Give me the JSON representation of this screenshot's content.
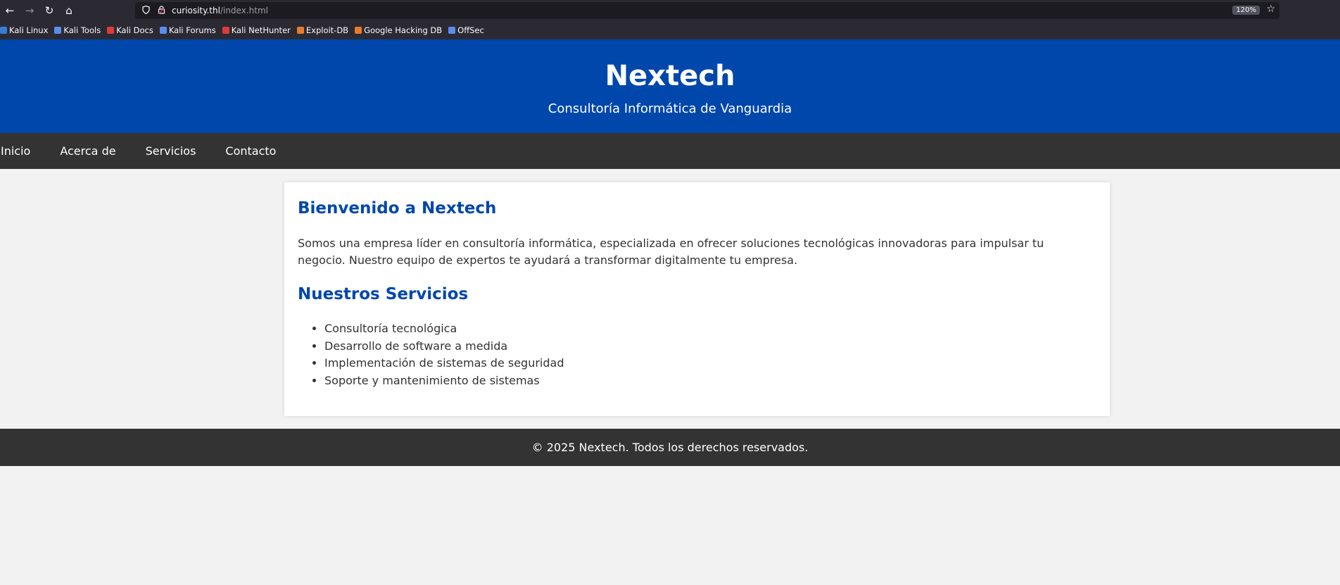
{
  "browser": {
    "nav": {
      "back": "←",
      "forward": "→",
      "reload": "↻",
      "home": "⌂"
    },
    "url": {
      "host": "curiosity.thl",
      "path": "/index.html"
    },
    "zoom": "120%",
    "bookmarks": [
      {
        "label": "Kali Linux",
        "color": "#3a7bd5"
      },
      {
        "label": "Kali Tools",
        "color": "#5b8def"
      },
      {
        "label": "Kali Docs",
        "color": "#e03a3a"
      },
      {
        "label": "Kali Forums",
        "color": "#5b8def"
      },
      {
        "label": "Kali NetHunter",
        "color": "#e03a3a"
      },
      {
        "label": "Exploit-DB",
        "color": "#e87a2c"
      },
      {
        "label": "Google Hacking DB",
        "color": "#e87a2c"
      },
      {
        "label": "OffSec",
        "color": "#5b8def"
      }
    ]
  },
  "header": {
    "title": "Nextech",
    "subtitle": "Consultoría Informática de Vanguardia"
  },
  "nav": {
    "items": [
      "Inicio",
      "Acerca de",
      "Servicios",
      "Contacto"
    ]
  },
  "main": {
    "welcome_heading": "Bienvenido a Nextech",
    "intro": "Somos una empresa líder en consultoría informática, especializada en ofrecer soluciones tecnológicas innovadoras para impulsar tu negocio. Nuestro equipo de expertos te ayudará a transformar digitalmente tu empresa.",
    "services_heading": "Nuestros Servicios",
    "services": [
      "Consultoría tecnológica",
      "Desarrollo de software a medida",
      "Implementación de sistemas de seguridad",
      "Soporte y mantenimiento de sistemas"
    ]
  },
  "footer": {
    "text": "© 2025 Nextech. Todos los derechos reservados."
  },
  "colors": {
    "header_bg": "#0047ab",
    "nav_bg": "#333333",
    "heading": "#0047ab",
    "page_bg": "#f2f2f2"
  }
}
